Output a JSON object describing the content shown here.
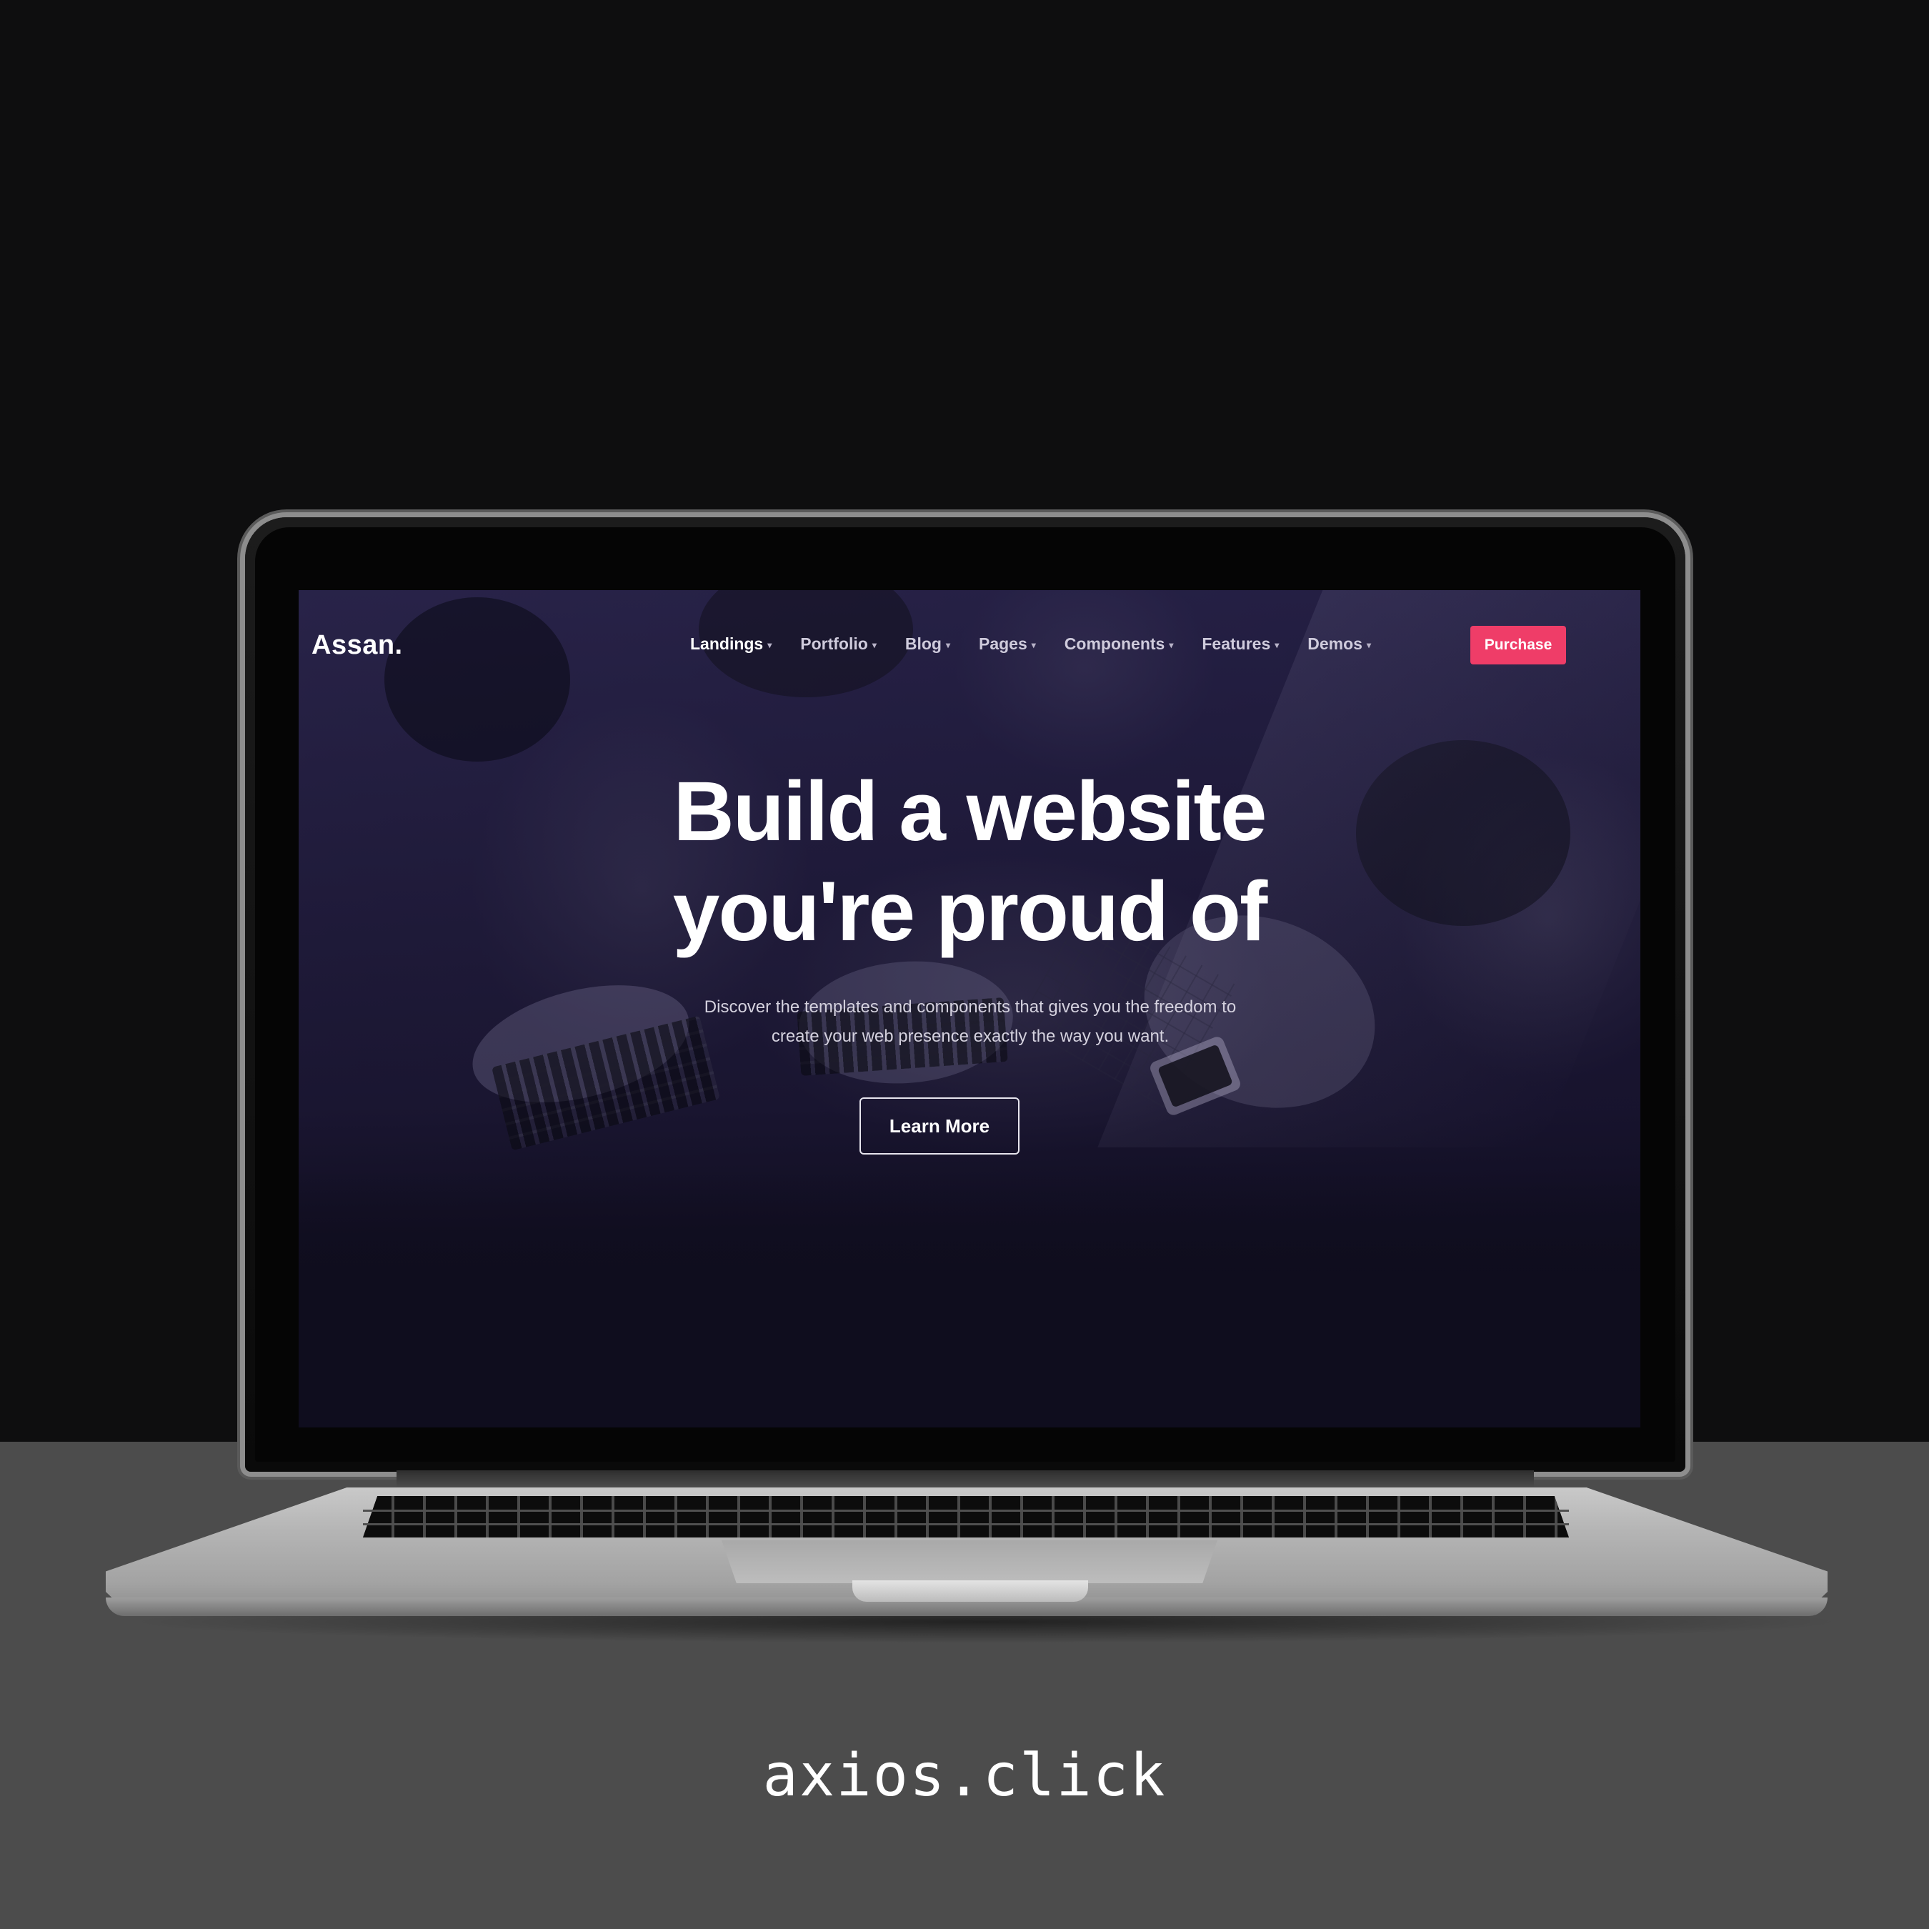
{
  "site": {
    "logo": "Assan.",
    "nav_items": [
      {
        "label": "Landings"
      },
      {
        "label": "Portfolio"
      },
      {
        "label": "Blog"
      },
      {
        "label": "Pages"
      },
      {
        "label": "Components"
      },
      {
        "label": "Features"
      },
      {
        "label": "Demos"
      }
    ],
    "caret": "▾",
    "purchase_label": "Purchase",
    "hero": {
      "title_line1": "Build a website",
      "title_line2": "you're proud of",
      "subtitle_line1": "Discover the templates and components that gives you the freedom to",
      "subtitle_line2": "create your web presence exactly the way you want.",
      "cta_label": "Learn More"
    }
  },
  "colors": {
    "accent": "#ef3d68",
    "background": "#0e0e0f",
    "floor": "#4c4c4c",
    "hero_overlay": "#211c42"
  },
  "caption": "axios.click"
}
